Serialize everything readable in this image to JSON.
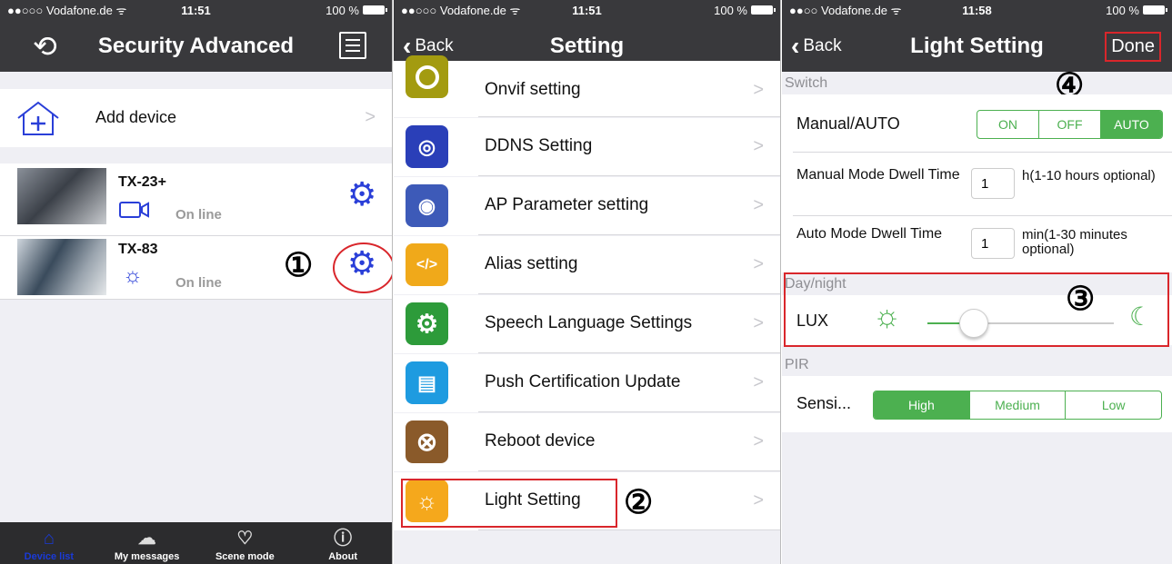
{
  "panel1": {
    "status": {
      "carrier": "●●○○○ Vodafone.de ᯤ",
      "time": "11:51",
      "battery": "100 %"
    },
    "title": "Security Advanced",
    "add_device": "Add device",
    "devices": [
      {
        "name": "TX-23+",
        "status": "On line"
      },
      {
        "name": "TX-83",
        "status": "On line"
      }
    ],
    "annotation": "①",
    "tabs": [
      {
        "label": "Device list"
      },
      {
        "label": "My messages"
      },
      {
        "label": "Scene mode"
      },
      {
        "label": "About"
      }
    ]
  },
  "panel2": {
    "status": {
      "carrier": "●●○○○ Vodafone.de ᯤ",
      "time": "11:51",
      "battery": "100 %"
    },
    "back": "Back",
    "title": "Setting",
    "items": [
      {
        "label": "Onvif setting",
        "color": "#a39b10"
      },
      {
        "label": "DDNS Setting",
        "color": "#2a3fb8"
      },
      {
        "label": "AP Parameter setting",
        "color": "#3d5ab8"
      },
      {
        "label": "Alias setting",
        "color": "#f0a91a"
      },
      {
        "label": "Speech Language Settings",
        "color": "#2d9b3a"
      },
      {
        "label": "Push Certification Update",
        "color": "#1e9be0"
      },
      {
        "label": "Reboot device",
        "color": "#8a5a2a"
      },
      {
        "label": "Light Setting",
        "color": "#f5a81c"
      }
    ],
    "annotation": "②"
  },
  "panel3": {
    "status": {
      "carrier": "●●○○ Vodafone.de ᯤ",
      "time": "11:58",
      "battery": "100 %"
    },
    "back": "Back",
    "title": "Light Setting",
    "done": "Done",
    "switch_header": "Switch",
    "manual_auto_label": "Manual/AUTO",
    "mode_options": [
      "ON",
      "OFF",
      "AUTO"
    ],
    "mode_selected": "AUTO",
    "manual_dwell_label": "Manual Mode Dwell Time",
    "manual_dwell_value": "1",
    "manual_dwell_hint": "h(1-10 hours optional)",
    "auto_dwell_label": "Auto Mode Dwell Time",
    "auto_dwell_value": "1",
    "auto_dwell_hint": "min(1-30 minutes optional)",
    "daynight_header": "Day/night",
    "lux_label": "LUX",
    "lux_slider_level": 0.25,
    "pir_header": "PIR",
    "sensi_label": "Sensi...",
    "sensi_options": [
      "High",
      "Medium",
      "Low"
    ],
    "sensi_selected": "High",
    "annotation3": "③",
    "annotation4": "④"
  },
  "colors": {
    "accent_green": "#4cb050",
    "nav_dark": "#39393c",
    "annotation_red": "#d9262b",
    "link_blue": "#2a3fd8"
  }
}
